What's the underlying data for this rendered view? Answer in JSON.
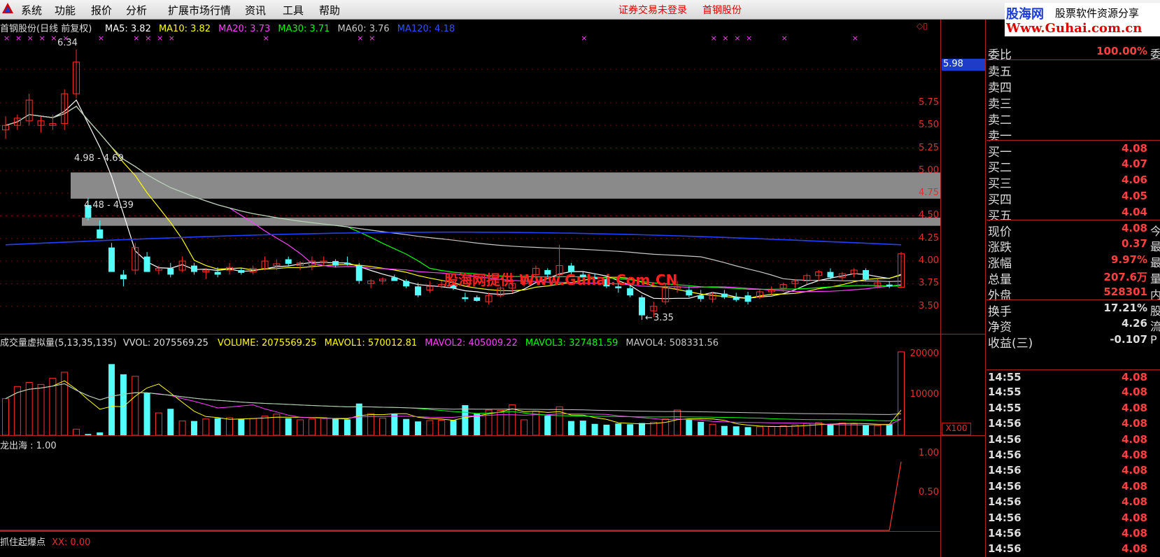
{
  "menu": {
    "items": [
      "系统",
      "功能",
      "报价",
      "分析",
      "扩展市场行情",
      "资讯",
      "工具",
      "帮助"
    ],
    "status_login": "证券交易未登录",
    "status_stock": "首钢股份"
  },
  "brand": {
    "name": "股海网",
    "slogan": "股票软件资源分享",
    "url": "Www.Guhai.com.cn"
  },
  "watermark": "股海网提供 Www.Guhai.Com.CN",
  "main_chart": {
    "title": "首钢股份(日线 前复权)",
    "ma": [
      {
        "label": "MA5: 3.82",
        "color": "#ffffff"
      },
      {
        "label": "MA10: 3.82",
        "color": "#ffff00"
      },
      {
        "label": "MA20: 3.73",
        "color": "#ff40ff"
      },
      {
        "label": "MA30: 3.71",
        "color": "#00ff00"
      },
      {
        "label": "MA60: 3.76",
        "color": "#c8c8c8"
      },
      {
        "label": "MA120: 4.18",
        "color": "#3050ff"
      }
    ],
    "high_label": "6.34",
    "low_label": "3.35",
    "band1_label": "4.98 - 4.69",
    "band2_label": "4.48 - 4.39",
    "current_price_tag": "5.98",
    "price_ticks": [
      "5.75",
      "5.50",
      "5.25",
      "5.00",
      "4.75",
      "4.50",
      "4.25",
      "4.00",
      "3.75",
      "3.50"
    ]
  },
  "chart_data": [
    {
      "type": "candlestick",
      "title": "首钢股份(日线 前复权)",
      "ylim": [
        3.25,
        6.5
      ],
      "candles_ohlc": [
        [
          5.45,
          5.6,
          5.35,
          5.5
        ],
        [
          5.5,
          5.62,
          5.45,
          5.58
        ],
        [
          5.55,
          5.85,
          5.5,
          5.78
        ],
        [
          5.5,
          5.6,
          5.42,
          5.55
        ],
        [
          5.5,
          5.62,
          5.45,
          5.52
        ],
        [
          5.52,
          5.9,
          5.45,
          5.85
        ],
        [
          5.85,
          6.34,
          5.8,
          6.2
        ],
        [
          4.62,
          4.7,
          4.45,
          4.48
        ],
        [
          4.35,
          4.45,
          4.25,
          4.25
        ],
        [
          4.15,
          4.2,
          3.88,
          3.88
        ],
        [
          3.85,
          3.9,
          3.72,
          3.8
        ],
        [
          3.9,
          4.2,
          3.85,
          4.15
        ],
        [
          4.05,
          4.1,
          3.88,
          3.88
        ],
        [
          3.9,
          3.95,
          3.85,
          3.92
        ],
        [
          3.92,
          3.98,
          3.82,
          3.85
        ],
        [
          3.9,
          4.05,
          3.88,
          4.0
        ],
        [
          3.95,
          3.98,
          3.85,
          3.88
        ],
        [
          3.88,
          3.92,
          3.8,
          3.9
        ],
        [
          3.88,
          3.93,
          3.82,
          3.85
        ],
        [
          3.9,
          3.98,
          3.85,
          3.93
        ],
        [
          3.9,
          3.92,
          3.85,
          3.87
        ],
        [
          3.88,
          3.95,
          3.85,
          3.92
        ],
        [
          3.92,
          4.05,
          3.9,
          4.0
        ],
        [
          3.95,
          4.02,
          3.9,
          3.97
        ],
        [
          4.02,
          4.05,
          3.95,
          3.97
        ],
        [
          3.95,
          4.0,
          3.9,
          3.98
        ],
        [
          3.95,
          4.05,
          3.9,
          4.0
        ],
        [
          3.98,
          4.05,
          3.95,
          4.0
        ],
        [
          4.0,
          4.02,
          3.93,
          3.95
        ],
        [
          3.98,
          4.05,
          3.95,
          3.97
        ],
        [
          3.95,
          3.98,
          3.75,
          3.78
        ],
        [
          3.75,
          3.8,
          3.7,
          3.78
        ],
        [
          3.78,
          3.82,
          3.74,
          3.8
        ],
        [
          3.82,
          3.85,
          3.78,
          3.78
        ],
        [
          3.78,
          3.8,
          3.7,
          3.72
        ],
        [
          3.72,
          3.76,
          3.6,
          3.62
        ],
        [
          3.68,
          3.78,
          3.65,
          3.72
        ],
        [
          3.72,
          3.78,
          3.7,
          3.74
        ],
        [
          3.74,
          3.78,
          3.68,
          3.7
        ],
        [
          3.6,
          3.65,
          3.55,
          3.58
        ],
        [
          3.6,
          3.62,
          3.55,
          3.56
        ],
        [
          3.55,
          3.65,
          3.52,
          3.62
        ],
        [
          3.62,
          3.72,
          3.6,
          3.7
        ],
        [
          3.7,
          3.8,
          3.65,
          3.75
        ],
        [
          3.75,
          3.85,
          3.72,
          3.82
        ],
        [
          3.85,
          3.95,
          3.8,
          3.92
        ],
        [
          3.9,
          3.92,
          3.82,
          3.85
        ],
        [
          3.85,
          4.18,
          3.82,
          3.95
        ],
        [
          3.95,
          3.98,
          3.85,
          3.88
        ],
        [
          3.85,
          3.88,
          3.78,
          3.82
        ],
        [
          3.82,
          3.86,
          3.76,
          3.8
        ],
        [
          3.8,
          3.82,
          3.7,
          3.72
        ],
        [
          3.72,
          3.75,
          3.65,
          3.7
        ],
        [
          3.7,
          3.74,
          3.6,
          3.62
        ],
        [
          3.6,
          3.62,
          3.35,
          3.4
        ],
        [
          3.45,
          3.55,
          3.38,
          3.5
        ],
        [
          3.55,
          3.75,
          3.52,
          3.7
        ],
        [
          3.7,
          3.78,
          3.65,
          3.72
        ],
        [
          3.68,
          3.72,
          3.6,
          3.62
        ],
        [
          3.62,
          3.68,
          3.55,
          3.58
        ],
        [
          3.58,
          3.66,
          3.54,
          3.64
        ],
        [
          3.64,
          3.68,
          3.58,
          3.6
        ],
        [
          3.6,
          3.65,
          3.55,
          3.57
        ],
        [
          3.62,
          3.66,
          3.52,
          3.55
        ],
        [
          3.6,
          3.68,
          3.58,
          3.66
        ],
        [
          3.66,
          3.72,
          3.62,
          3.68
        ],
        [
          3.7,
          3.76,
          3.66,
          3.74
        ],
        [
          3.75,
          3.8,
          3.7,
          3.78
        ],
        [
          3.78,
          3.86,
          3.74,
          3.84
        ],
        [
          3.84,
          3.9,
          3.78,
          3.88
        ],
        [
          3.88,
          3.92,
          3.8,
          3.82
        ],
        [
          3.82,
          3.88,
          3.78,
          3.86
        ],
        [
          3.86,
          3.92,
          3.82,
          3.9
        ],
        [
          3.9,
          3.92,
          3.78,
          3.8
        ],
        [
          3.72,
          3.8,
          3.7,
          3.76
        ],
        [
          3.74,
          3.78,
          3.7,
          3.72
        ],
        [
          3.71,
          4.1,
          3.7,
          4.08
        ]
      ]
    },
    {
      "type": "bar",
      "title": "成交量虚拟量(5,13,35,135)",
      "series": [
        {
          "name": "VVOL",
          "values": [
            2075569.25
          ]
        },
        {
          "name": "VOLUME",
          "values": [
            2075569.25
          ]
        },
        {
          "name": "MAVOL1",
          "values": [
            570012.81
          ]
        },
        {
          "name": "MAVOL2",
          "values": [
            405009.22
          ]
        },
        {
          "name": "MAVOL3",
          "values": [
            327481.59
          ]
        },
        {
          "name": "MAVOL4",
          "values": [
            508331.56
          ]
        }
      ],
      "volume_hundreds": [
        9000,
        12000,
        13000,
        12500,
        14000,
        15500,
        1500,
        300,
        700,
        17500,
        15000,
        14500,
        10500,
        5500,
        6500,
        3500,
        3500,
        4000,
        4200,
        4300,
        4000,
        4100,
        4700,
        5200,
        4200,
        3800,
        4000,
        4300,
        4100,
        3900,
        7800,
        5300,
        4200,
        5200,
        4000,
        3400,
        3600,
        3700,
        3700,
        7400,
        5300,
        6200,
        6100,
        7500,
        3800,
        5900,
        4800,
        7000,
        3500,
        3600,
        2800,
        2600,
        2900,
        2700,
        3000,
        3200,
        4000,
        6200,
        3800,
        3300,
        2700,
        2300,
        2200,
        2000,
        2100,
        2200,
        2300,
        2500,
        2900,
        3100,
        2800,
        3000,
        2800,
        2500,
        2400,
        2700,
        20500
      ],
      "ylim": [
        0,
        21000
      ]
    },
    {
      "type": "line",
      "title": "龙出海",
      "values_tail": [
        0.0,
        1.0
      ],
      "ylim": [
        0,
        1.2
      ]
    }
  ],
  "volume_chart": {
    "title": "成交量虚拟量",
    "params": "(5,13,35,135)",
    "vvol": "VVOL: 2075569.25",
    "volume": "VOLUME: 2075569.25",
    "mavol1": "MAVOL1: 570012.81",
    "mavol2": "MAVOL2: 405009.22",
    "mavol3": "MAVOL3: 327481.59",
    "mavol4": "MAVOL4: 508331.56",
    "ticks": [
      "20000",
      "10000"
    ],
    "unit": "X100"
  },
  "indicator": {
    "title": "龙出海",
    "value": " : 1.00",
    "ticks": [
      "1.00",
      "0.50"
    ],
    "bottom_title": "抓住起爆点",
    "xx_label": "XX: 0.00"
  },
  "quote_panel": {
    "webi": {
      "k": "委比",
      "v": "100.00%",
      "s": "委"
    },
    "sell": [
      "卖五",
      "卖四",
      "卖三",
      "卖二",
      "卖一"
    ],
    "buy": [
      {
        "k": "买一",
        "v": "4.08"
      },
      {
        "k": "买二",
        "v": "4.07"
      },
      {
        "k": "买三",
        "v": "4.06"
      },
      {
        "k": "买四",
        "v": "4.05"
      },
      {
        "k": "买五",
        "v": "4.04"
      }
    ],
    "stats": [
      {
        "k": "现价",
        "v": "4.08",
        "s": "今"
      },
      {
        "k": "涨跌",
        "v": "0.37",
        "s": "最"
      },
      {
        "k": "涨幅",
        "v": "9.97%",
        "s": "最"
      },
      {
        "k": "总量",
        "v": "207.6万",
        "s": "量"
      },
      {
        "k": "外盘",
        "v": "528301",
        "s": "内"
      }
    ],
    "fund": [
      {
        "k": "换手",
        "v": "17.21%",
        "s": "股"
      },
      {
        "k": "净资",
        "v": "4.26",
        "s": "流"
      },
      {
        "k": "收益(三)",
        "v": "-0.107",
        "s": "P"
      }
    ],
    "ticks": [
      {
        "t": "14:55",
        "p": "4.08"
      },
      {
        "t": "14:55",
        "p": "4.08"
      },
      {
        "t": "14:55",
        "p": "4.08"
      },
      {
        "t": "14:56",
        "p": "4.08"
      },
      {
        "t": "14:56",
        "p": "4.08"
      },
      {
        "t": "14:56",
        "p": "4.08"
      },
      {
        "t": "14:56",
        "p": "4.08"
      },
      {
        "t": "14:56",
        "p": "4.08"
      },
      {
        "t": "14:56",
        "p": "4.08"
      },
      {
        "t": "14:56",
        "p": "4.08"
      },
      {
        "t": "14:56",
        "p": "4.08"
      },
      {
        "t": "14:56",
        "p": "4.08"
      }
    ]
  },
  "colors": {
    "up": "#ff3030",
    "down": "#54ffff",
    "grid": "#b02020",
    "band": "#8a8a8a"
  }
}
